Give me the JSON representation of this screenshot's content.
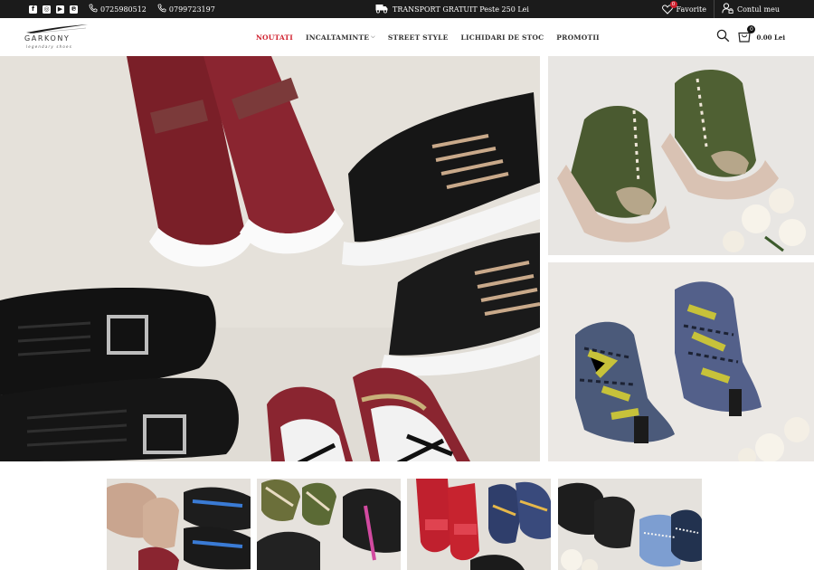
{
  "topbar": {
    "social": [
      {
        "name": "facebook-icon",
        "glyph": "f"
      },
      {
        "name": "instagram-icon",
        "glyph": "◎"
      },
      {
        "name": "youtube-icon",
        "glyph": "▶"
      },
      {
        "name": "pinterest-icon",
        "glyph": "℗"
      }
    ],
    "phone1": "0725980512",
    "phone2": "0799723197",
    "shipping": "TRANSPORT GRATUIT Peste 250 Lei",
    "favorites_label": "Favorite",
    "favorites_count": "0",
    "account_label": "Contul meu"
  },
  "header": {
    "logo_name": "GARKONY",
    "logo_tagline": "legendary shoes",
    "nav": [
      "NOUTATI",
      "INCALTAMINTE",
      "STREET STYLE",
      "LICHIDARI DE STOC",
      "PROMOTII"
    ],
    "active_nav": "NOUTATI",
    "nav_dropdown_item": "INCALTAMINTE",
    "cart_count": "0",
    "cart_total": "0.00 Lei"
  },
  "colors": {
    "topbar_bg": "#1b1b1b",
    "accent": "#d0202e",
    "text": "#333333"
  },
  "images": {
    "hero_main": "shoes-circle-photo",
    "hero_side_top": "green-boots-photo",
    "hero_side_bottom": "snake-print-boots-photo",
    "thumbnails": [
      "sneakers-mix-photo",
      "green-sneakers-photo",
      "red-loafers-photo",
      "brogues-photo"
    ]
  }
}
